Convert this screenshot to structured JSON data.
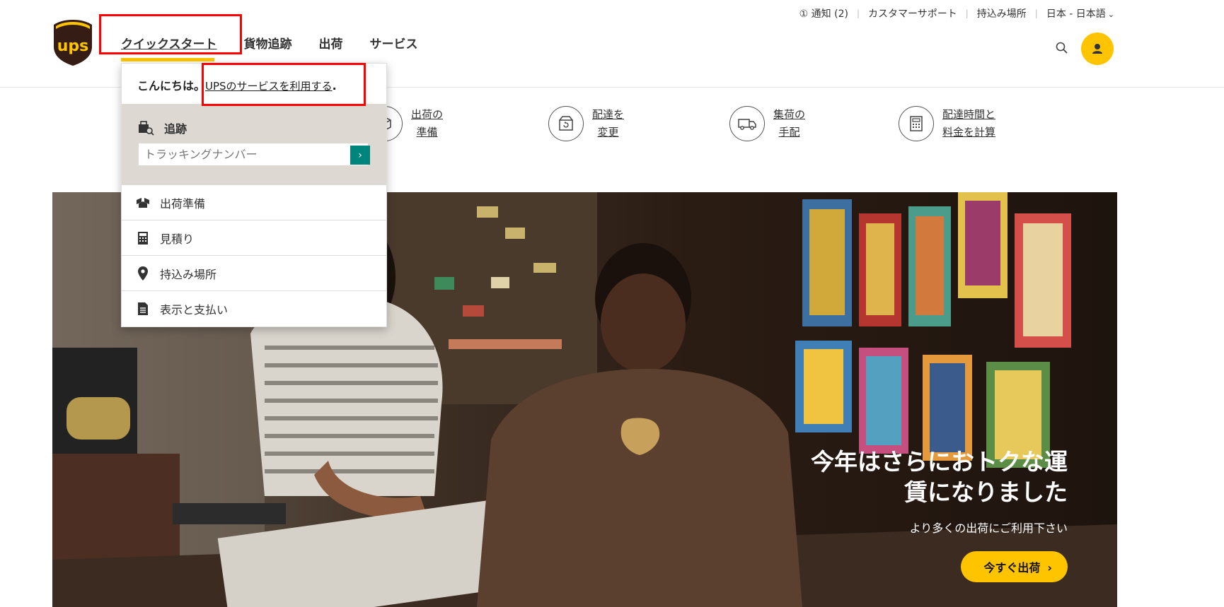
{
  "utility": {
    "notice": "① 通知 (2)",
    "support": "カスタマーサポート",
    "locations": "持込み場所",
    "locale": "日本 - 日本語"
  },
  "brand": {
    "logo_text": "ups",
    "accent": "#ffc400",
    "brown": "#351c15"
  },
  "nav": {
    "items": [
      "クイックスタート",
      "貨物追跡",
      "出荷",
      "サービス"
    ],
    "active": "クイックスタート"
  },
  "quick_actions": [
    {
      "line1": "出荷の",
      "line2": "準備",
      "icon": "box-icon"
    },
    {
      "line1": "配達を",
      "line2": "変更",
      "icon": "package-return-icon"
    },
    {
      "line1": "集荷の",
      "line2": "手配",
      "icon": "truck-icon"
    },
    {
      "line1": "配達時間と",
      "line2": "料金を計算",
      "icon": "calculator-icon"
    }
  ],
  "dropdown": {
    "greeting": "こんにちは。",
    "service_link": "UPSのサービスを利用する",
    "period": ".",
    "track_title": "追跡",
    "track_placeholder": "トラッキングナンバー",
    "go": "›",
    "items": [
      {
        "label": "出荷準備",
        "icon": "shipping-box-icon"
      },
      {
        "label": "見積り",
        "icon": "calculator-icon"
      },
      {
        "label": "持込み場所",
        "icon": "location-pin-icon"
      },
      {
        "label": "表示と支払い",
        "icon": "document-icon"
      }
    ]
  },
  "hero": {
    "title_line1": "今年はさらにおトクな運",
    "title_line2": "賃になりました",
    "subtitle": "より多くの出荷にご利用下さい",
    "cta": "今すぐ出荷",
    "cta_arrow": "›"
  }
}
